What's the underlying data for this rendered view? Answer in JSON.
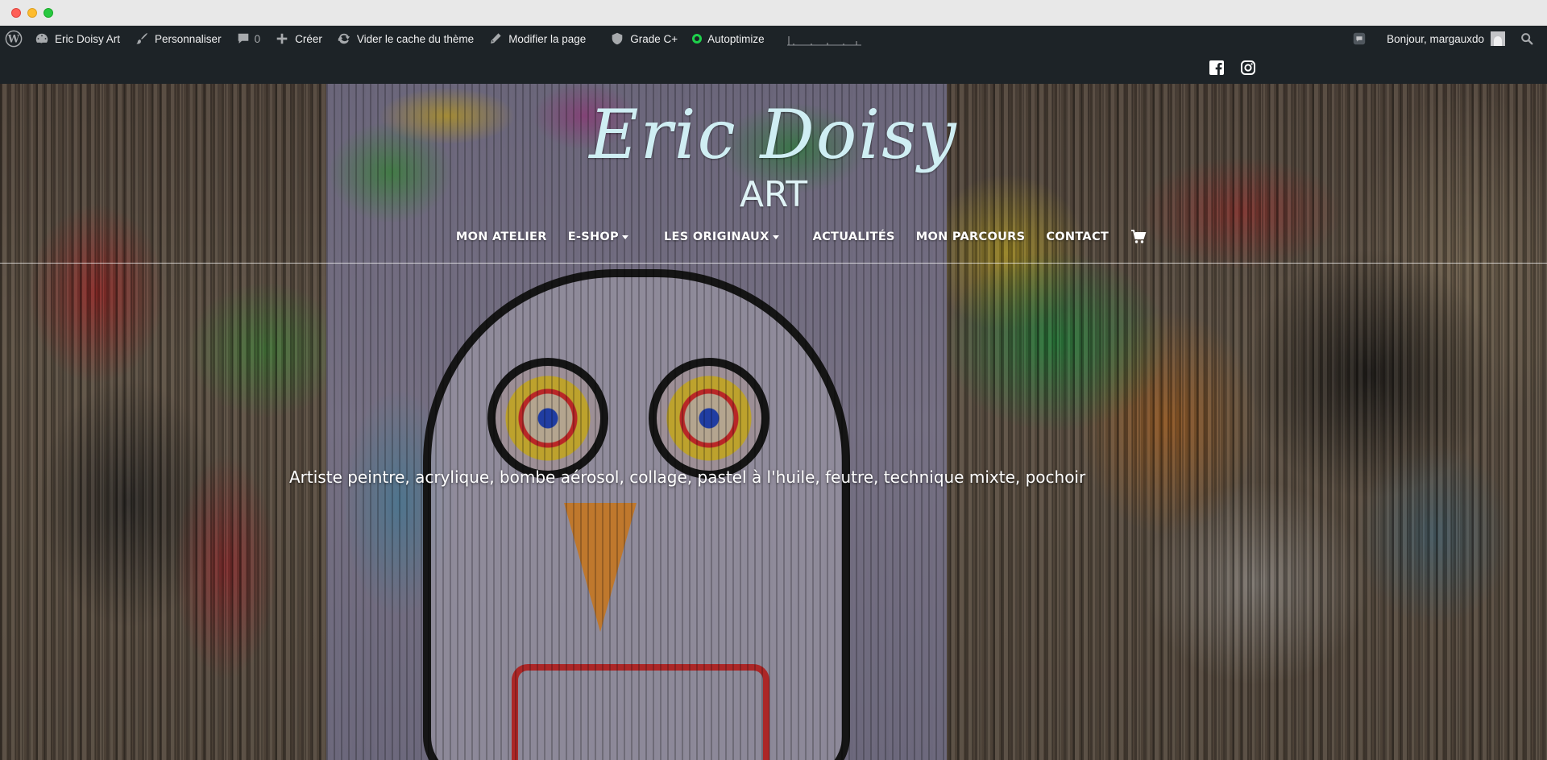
{
  "adminbar": {
    "site_name": "Eric Doisy Art",
    "customize": "Personnaliser",
    "comments_count": "0",
    "create": "Créer",
    "clear_cache": "Vider le cache du thème",
    "edit_page": "Modifier la page",
    "grade": "Grade C+",
    "autoptimize": "Autoptimize",
    "greeting": "Bonjour, margauxdo"
  },
  "site": {
    "name": "Eric Doisy",
    "subtitle": "ART",
    "tagline": "Artiste peintre, acrylique, bombe aérosol, collage, pastel à l'huile, feutre, technique mixte, pochoir"
  },
  "nav": {
    "items": [
      "MON ATELIER",
      "E-SHOP",
      "LES ORIGINAUX",
      "ACTUALITÉS",
      "MON PARCOURS",
      "CONTACT"
    ]
  },
  "colors": {
    "adminbar_bg": "#1d2327",
    "brand_text": "#cfeef3",
    "autoptimize_status": "#1ed14b"
  },
  "icons": {
    "wordpress": "wordpress-icon",
    "dashboard": "dashboard-icon",
    "customize": "brush-icon",
    "comments": "comment-icon",
    "create": "plus-icon",
    "cache": "refresh-icon",
    "edit": "pencil-icon",
    "grade": "shield-icon",
    "search": "search-icon",
    "facebook": "facebook-icon",
    "instagram": "instagram-icon",
    "cart": "cart-icon"
  }
}
